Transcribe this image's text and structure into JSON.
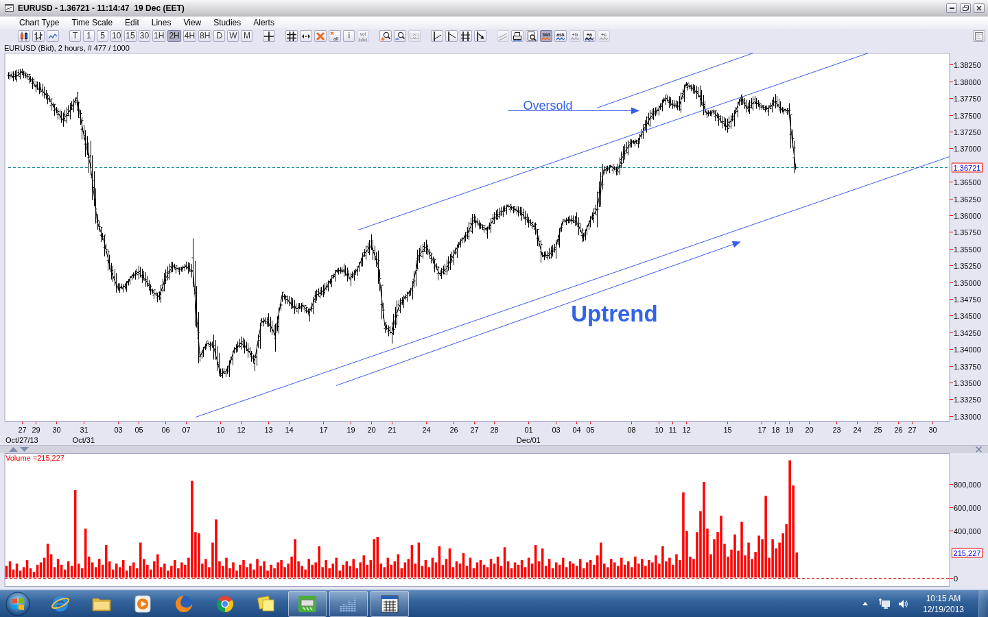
{
  "window": {
    "title": "EURUSD - 1.36721 - 11:14:47  19 Dec (EET)"
  },
  "menu": [
    "Chart Type",
    "Time Scale",
    "Edit",
    "Lines",
    "View",
    "Studies",
    "Alerts"
  ],
  "toolbar": [
    [
      {
        "kind": "icon",
        "selected": false,
        "disabled": false
      },
      {
        "kind": "icon",
        "selected": false,
        "disabled": false
      },
      {
        "kind": "icon",
        "selected": false,
        "disabled": false
      }
    ],
    [
      {
        "kind": "text",
        "label": "T",
        "selected": false,
        "disabled": false
      },
      {
        "kind": "text",
        "label": "1",
        "selected": false,
        "disabled": false
      },
      {
        "kind": "text",
        "label": "5",
        "selected": false,
        "disabled": false
      },
      {
        "kind": "text",
        "label": "10",
        "selected": false,
        "disabled": false
      },
      {
        "kind": "text",
        "label": "15",
        "selected": false,
        "disabled": false
      },
      {
        "kind": "text",
        "label": "30",
        "selected": false,
        "disabled": false
      },
      {
        "kind": "text",
        "label": "1H",
        "selected": false,
        "disabled": false
      },
      {
        "kind": "text",
        "label": "2H",
        "selected": true,
        "disabled": false
      },
      {
        "kind": "text",
        "label": "4H",
        "selected": false,
        "disabled": false
      },
      {
        "kind": "text",
        "label": "8H",
        "selected": false,
        "disabled": false
      },
      {
        "kind": "text",
        "label": "D",
        "selected": false,
        "disabled": false
      },
      {
        "kind": "text",
        "label": "W",
        "selected": false,
        "disabled": false
      },
      {
        "kind": "text",
        "label": "M",
        "selected": false,
        "disabled": false
      }
    ],
    [
      {
        "kind": "icon",
        "selected": false,
        "disabled": false
      }
    ],
    [
      {
        "kind": "icon",
        "selected": false,
        "disabled": false
      },
      {
        "kind": "icon",
        "selected": false,
        "disabled": false
      },
      {
        "kind": "icon",
        "selected": false,
        "disabled": false
      },
      {
        "kind": "icon",
        "label": "all",
        "selected": false,
        "disabled": false
      },
      {
        "kind": "text",
        "label": "i",
        "selected": false,
        "disabled": false
      },
      {
        "kind": "icon",
        "label": "vol",
        "selected": false,
        "disabled": true
      }
    ],
    [
      {
        "kind": "icon",
        "selected": false,
        "disabled": false
      },
      {
        "kind": "icon",
        "selected": false,
        "disabled": false
      },
      {
        "kind": "icon",
        "selected": false,
        "disabled": true
      }
    ],
    [
      {
        "kind": "icon",
        "selected": false,
        "disabled": false
      },
      {
        "kind": "icon",
        "selected": false,
        "disabled": false
      },
      {
        "kind": "icon",
        "selected": false,
        "disabled": false
      },
      {
        "kind": "icon",
        "selected": false,
        "disabled": false
      }
    ],
    [
      {
        "kind": "icon",
        "selected": false,
        "disabled": true
      },
      {
        "kind": "icon",
        "selected": false,
        "disabled": false
      },
      {
        "kind": "icon",
        "selected": false,
        "disabled": false
      },
      {
        "kind": "icon",
        "label": "bid",
        "selected": true,
        "disabled": false
      },
      {
        "kind": "icon",
        "label": "ask",
        "selected": false,
        "disabled": false
      },
      {
        "kind": "icon",
        "label": "+b",
        "selected": false,
        "disabled": true
      },
      {
        "kind": "icon",
        "label": "+a",
        "selected": false,
        "disabled": false
      },
      {
        "kind": "icon",
        "label": "+c",
        "selected": false,
        "disabled": true
      }
    ],
    [
      {
        "kind": "icon",
        "selected": false,
        "disabled": false
      }
    ]
  ],
  "price_panel": {
    "chart_data": {
      "type": "line",
      "title": "EURUSD (Bid), 2 hours, # 477 / 1000",
      "categories": [
        null,
        null,
        "27",
        null,
        "29",
        null,
        null,
        "30",
        null,
        null,
        null,
        "31",
        null,
        null,
        null,
        null,
        "03",
        null,
        null,
        "05",
        null,
        null,
        null,
        "06",
        null,
        null,
        "07",
        null,
        null,
        null,
        null,
        "10",
        null,
        null,
        "12",
        null,
        null,
        null,
        "13",
        null,
        null,
        "14",
        null,
        null,
        null,
        null,
        "17",
        null,
        null,
        null,
        "19",
        null,
        null,
        "20",
        null,
        null,
        "21",
        null,
        null,
        null,
        null,
        "24",
        null,
        null,
        null,
        "26",
        null,
        null,
        "27",
        null,
        null,
        "28",
        null,
        null,
        null,
        null,
        "01",
        null,
        null,
        null,
        "03",
        null,
        null,
        "04",
        null,
        "05",
        null,
        null,
        null,
        null,
        null,
        "08",
        null,
        null,
        null,
        "10",
        null,
        "11",
        null,
        "12",
        null,
        null,
        null,
        null,
        null,
        "15",
        null,
        null,
        null,
        null,
        "17",
        null,
        "18",
        null,
        "19",
        null,
        null,
        "20",
        null,
        null,
        null,
        "23",
        null,
        null,
        "24",
        null,
        null,
        "25",
        null,
        null,
        "26",
        null,
        "27",
        null,
        null,
        "30",
        null,
        null
      ],
      "values": [
        1.3809,
        1.3807,
        1.3814,
        1.3807,
        1.3793,
        1.3786,
        1.3773,
        1.3757,
        1.3742,
        1.3757,
        1.3776,
        1.3722,
        1.3675,
        1.3591,
        1.3561,
        1.3517,
        1.3491,
        1.3493,
        1.3509,
        1.3515,
        1.3504,
        1.3487,
        1.3478,
        1.3506,
        1.3524,
        1.3519,
        1.3524,
        1.3515,
        1.3389,
        1.3409,
        1.3404,
        1.3363,
        1.3368,
        1.3399,
        1.3409,
        1.3399,
        1.3383,
        1.3442,
        1.344,
        1.3421,
        1.3481,
        1.3471,
        1.346,
        1.3465,
        1.3455,
        1.3481,
        1.3486,
        1.3501,
        1.3517,
        1.3517,
        1.3506,
        1.352,
        1.3542,
        1.3555,
        1.3527,
        1.3435,
        1.3424,
        1.3462,
        1.3478,
        1.3491,
        1.354,
        1.3553,
        1.3534,
        1.3512,
        1.352,
        1.354,
        1.3561,
        1.3571,
        1.3593,
        1.3585,
        1.3578,
        1.3596,
        1.3604,
        1.3614,
        1.3609,
        1.3602,
        1.3591,
        1.3583,
        1.354,
        1.354,
        1.3553,
        1.3591,
        1.3593,
        1.3591,
        1.3568,
        1.3593,
        1.3609,
        1.3667,
        1.3673,
        1.3667,
        1.3694,
        1.3709,
        1.3711,
        1.3732,
        1.3749,
        1.3759,
        1.3776,
        1.3765,
        1.3763,
        1.3796,
        1.379,
        1.3778,
        1.3752,
        1.3755,
        1.3742,
        1.3732,
        1.3749,
        1.3776,
        1.3759,
        1.377,
        1.3763,
        1.3759,
        1.377,
        1.3757,
        1.3757,
        1.3672,
        null,
        null,
        null,
        null,
        null,
        null,
        null,
        null,
        null,
        null,
        null,
        null,
        null,
        null,
        null,
        null,
        null,
        null,
        null,
        null,
        null,
        null
      ],
      "ylim": [
        1.32922,
        1.38424
      ],
      "yticks": [
        {
          "value": 1.3825,
          "label": "1.38250"
        },
        {
          "value": 1.38,
          "label": "1.38000"
        },
        {
          "value": 1.3775,
          "label": "1.37750"
        },
        {
          "value": 1.375,
          "label": "1.37500"
        },
        {
          "value": 1.3725,
          "label": "1.37250"
        },
        {
          "value": 1.37,
          "label": "1.37000"
        },
        {
          "value": 1.365,
          "label": "1.36500"
        },
        {
          "value": 1.3625,
          "label": "1.36250"
        },
        {
          "value": 1.36,
          "label": "1.36000"
        },
        {
          "value": 1.3575,
          "label": "1.35750"
        },
        {
          "value": 1.355,
          "label": "1.35500"
        },
        {
          "value": 1.3525,
          "label": "1.35250"
        },
        {
          "value": 1.35,
          "label": "1.35000"
        },
        {
          "value": 1.3475,
          "label": "1.34750"
        },
        {
          "value": 1.345,
          "label": "1.34500"
        },
        {
          "value": 1.3425,
          "label": "1.34250"
        },
        {
          "value": 1.34,
          "label": "1.34000"
        },
        {
          "value": 1.3375,
          "label": "1.33750"
        },
        {
          "value": 1.335,
          "label": "1.33500"
        },
        {
          "value": 1.3325,
          "label": "1.33250"
        },
        {
          "value": 1.33,
          "label": "1.33000"
        }
      ],
      "ref_lines": [
        {
          "axis": "y",
          "value": 1.36721,
          "label": "1.36721"
        }
      ],
      "annotations": [
        "Oversold",
        "Uptrend"
      ]
    },
    "period_labels": [
      "Oct/27/13",
      "Oct/31",
      "Dec/01"
    ]
  },
  "volume_panel": {
    "label": "Volume =215,227",
    "current_label": "215,227",
    "chart_data": {
      "type": "bar",
      "categories": [
        null,
        null,
        null,
        null,
        null,
        null,
        null,
        null,
        null,
        null,
        null,
        null,
        null,
        null,
        null,
        null,
        null,
        null,
        null,
        null,
        null,
        null,
        null,
        null,
        null,
        null,
        null,
        null,
        null,
        null,
        null,
        null,
        null,
        null,
        null,
        null,
        null,
        null,
        null,
        null,
        null,
        null,
        null,
        null,
        null,
        null,
        null,
        null,
        null,
        null,
        null,
        null,
        null,
        null,
        null,
        null,
        null,
        null,
        null,
        null,
        null,
        null,
        null,
        null,
        null,
        null,
        null,
        null,
        null,
        null,
        null,
        null,
        null,
        null,
        null,
        null,
        null,
        null,
        null,
        null,
        null,
        null,
        null,
        null,
        null,
        null,
        null,
        null,
        null,
        null,
        null,
        null,
        null,
        null,
        null,
        null,
        null,
        null,
        null,
        null,
        null,
        null,
        null,
        null,
        null,
        null,
        null,
        null,
        null,
        null,
        null,
        null,
        null,
        null,
        null,
        null,
        null,
        null,
        null,
        null,
        null,
        null,
        null,
        null,
        null,
        null,
        null,
        null,
        null,
        null,
        null,
        null,
        null,
        null,
        null,
        null,
        null,
        null,
        null,
        null,
        null,
        null,
        null,
        null,
        null,
        null,
        null,
        null,
        null,
        null,
        null,
        null,
        null,
        null,
        null,
        null,
        null,
        null,
        null,
        null,
        null,
        null,
        null,
        null,
        null,
        null,
        null,
        null,
        null,
        null,
        null,
        null,
        null,
        null,
        null,
        null,
        null,
        null,
        null,
        null,
        null,
        null,
        null,
        null,
        null,
        null,
        null,
        null,
        null,
        null,
        null,
        null,
        null,
        null,
        null,
        null,
        null,
        null,
        null,
        null,
        null,
        null,
        null,
        null,
        null,
        null,
        null,
        null,
        null,
        null,
        null,
        null,
        null,
        null,
        null,
        null,
        null,
        null,
        null,
        null,
        null,
        null,
        null,
        null,
        null,
        null,
        null,
        null,
        null,
        null,
        null,
        null,
        null,
        null,
        null,
        null,
        null,
        null,
        null,
        null,
        null,
        null,
        null,
        null,
        null,
        null,
        null,
        null,
        null,
        null,
        null,
        null,
        null,
        null,
        null,
        null,
        null,
        null,
        null,
        null,
        null,
        null,
        null,
        null,
        null,
        null,
        null,
        null,
        null,
        null,
        null,
        null,
        null,
        null,
        null
      ],
      "values": [
        100000,
        140000,
        70000,
        120000,
        60000,
        90000,
        150000,
        80000,
        50000,
        110000,
        130000,
        170000,
        290000,
        200000,
        90000,
        160000,
        110000,
        70000,
        140000,
        100000,
        750000,
        120000,
        80000,
        420000,
        180000,
        130000,
        90000,
        160000,
        110000,
        280000,
        140000,
        70000,
        120000,
        90000,
        150000,
        60000,
        100000,
        130000,
        80000,
        300000,
        160000,
        110000,
        70000,
        140000,
        200000,
        90000,
        120000,
        60000,
        100000,
        150000,
        80000,
        130000,
        110000,
        170000,
        830000,
        390000,
        380000,
        120000,
        160000,
        90000,
        300000,
        500000,
        140000,
        100000,
        170000,
        80000,
        130000,
        60000,
        110000,
        150000,
        90000,
        120000,
        70000,
        160000,
        100000,
        140000,
        60000,
        110000,
        80000,
        130000,
        150000,
        90000,
        120000,
        180000,
        330000,
        140000,
        100000,
        70000,
        160000,
        110000,
        130000,
        270000,
        90000,
        150000,
        80000,
        120000,
        170000,
        60000,
        110000,
        140000,
        100000,
        160000,
        80000,
        130000,
        190000,
        110000,
        150000,
        330000,
        350000,
        120000,
        90000,
        170000,
        110000,
        140000,
        200000,
        80000,
        130000,
        160000,
        280000,
        120000,
        300000,
        100000,
        150000,
        90000,
        170000,
        130000,
        270000,
        110000,
        160000,
        250000,
        90000,
        140000,
        120000,
        210000,
        100000,
        170000,
        80000,
        130000,
        150000,
        110000,
        90000,
        160000,
        120000,
        180000,
        100000,
        260000,
        140000,
        80000,
        130000,
        110000,
        150000,
        90000,
        170000,
        120000,
        280000,
        140000,
        250000,
        100000,
        160000,
        80000,
        130000,
        110000,
        170000,
        90000,
        140000,
        120000,
        100000,
        160000,
        80000,
        130000,
        150000,
        110000,
        190000,
        300000,
        120000,
        90000,
        160000,
        130000,
        100000,
        170000,
        110000,
        140000,
        90000,
        180000,
        120000,
        160000,
        100000,
        150000,
        130000,
        190000,
        120000,
        270000,
        140000,
        170000,
        110000,
        200000,
        150000,
        730000,
        400000,
        180000,
        160000,
        390000,
        570000,
        820000,
        420000,
        200000,
        330000,
        390000,
        530000,
        290000,
        180000,
        240000,
        370000,
        230000,
        480000,
        190000,
        300000,
        160000,
        220000,
        360000,
        330000,
        700000,
        170000,
        330000,
        250000,
        300000,
        380000,
        460000,
        1005000,
        790000,
        215227,
        null,
        null,
        null,
        null,
        null,
        null,
        null,
        null,
        null,
        null,
        null,
        null,
        null,
        null,
        null,
        null,
        null,
        null,
        null,
        null,
        null,
        null,
        null,
        null,
        null,
        null,
        null,
        null,
        null,
        null,
        null,
        null,
        null,
        null,
        null,
        null,
        null,
        null,
        null,
        null,
        null,
        null,
        null,
        null
      ],
      "ylim": [
        -76000,
        1064000
      ],
      "yticks": [
        {
          "value": 800000,
          "label": "800,000"
        },
        {
          "value": 600000,
          "label": "600,000"
        },
        {
          "value": 400000,
          "label": "400,000"
        },
        {
          "value": 0,
          "label": "0"
        }
      ],
      "ref_lines": [
        {
          "axis": "y",
          "value": 0
        }
      ]
    }
  },
  "taskbar": {
    "apps": [
      {
        "running": false
      },
      {
        "running": false
      },
      {
        "running": false
      },
      {
        "running": false
      },
      {
        "running": false
      },
      {
        "running": false
      },
      {
        "running": true
      },
      {
        "running": true
      },
      {
        "running": true
      }
    ],
    "clock": {
      "time": "10:15 AM",
      "date": "12/19/2013"
    }
  }
}
